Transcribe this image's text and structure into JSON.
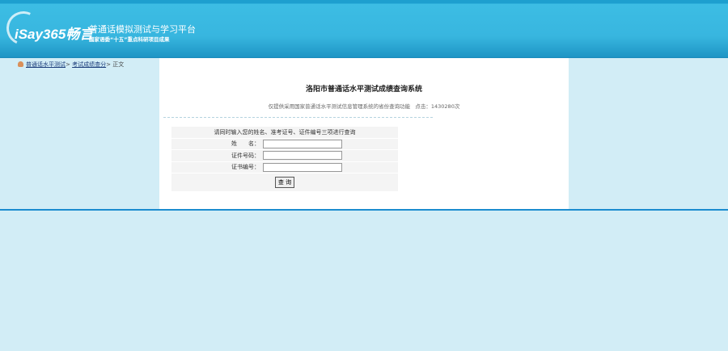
{
  "header": {
    "brand": "iSay365畅言",
    "title": "普通话模拟测试与学习平台",
    "subtitle": "国家语委“十五”重点科研项目成果"
  },
  "breadcrumb": {
    "items": [
      "普通话水平测试",
      "考试成绩查分"
    ],
    "current": "正文",
    "sep": ">"
  },
  "main": {
    "title": "洛阳市普通话水平测试成绩查询系统",
    "notice": "仅提供采用国家普通话水平测试信息管理系统的省份查询功能",
    "clicks_label": "点击：",
    "clicks": "1430280次"
  },
  "form": {
    "instruction": "请同时输入您的姓名、准考证号、证件编号三项进行查询",
    "fields": [
      {
        "label": "姓　　名：",
        "value": ""
      },
      {
        "label": "证件号码：",
        "value": ""
      },
      {
        "label": "证书编号：",
        "value": ""
      }
    ],
    "submit": "查 询"
  }
}
